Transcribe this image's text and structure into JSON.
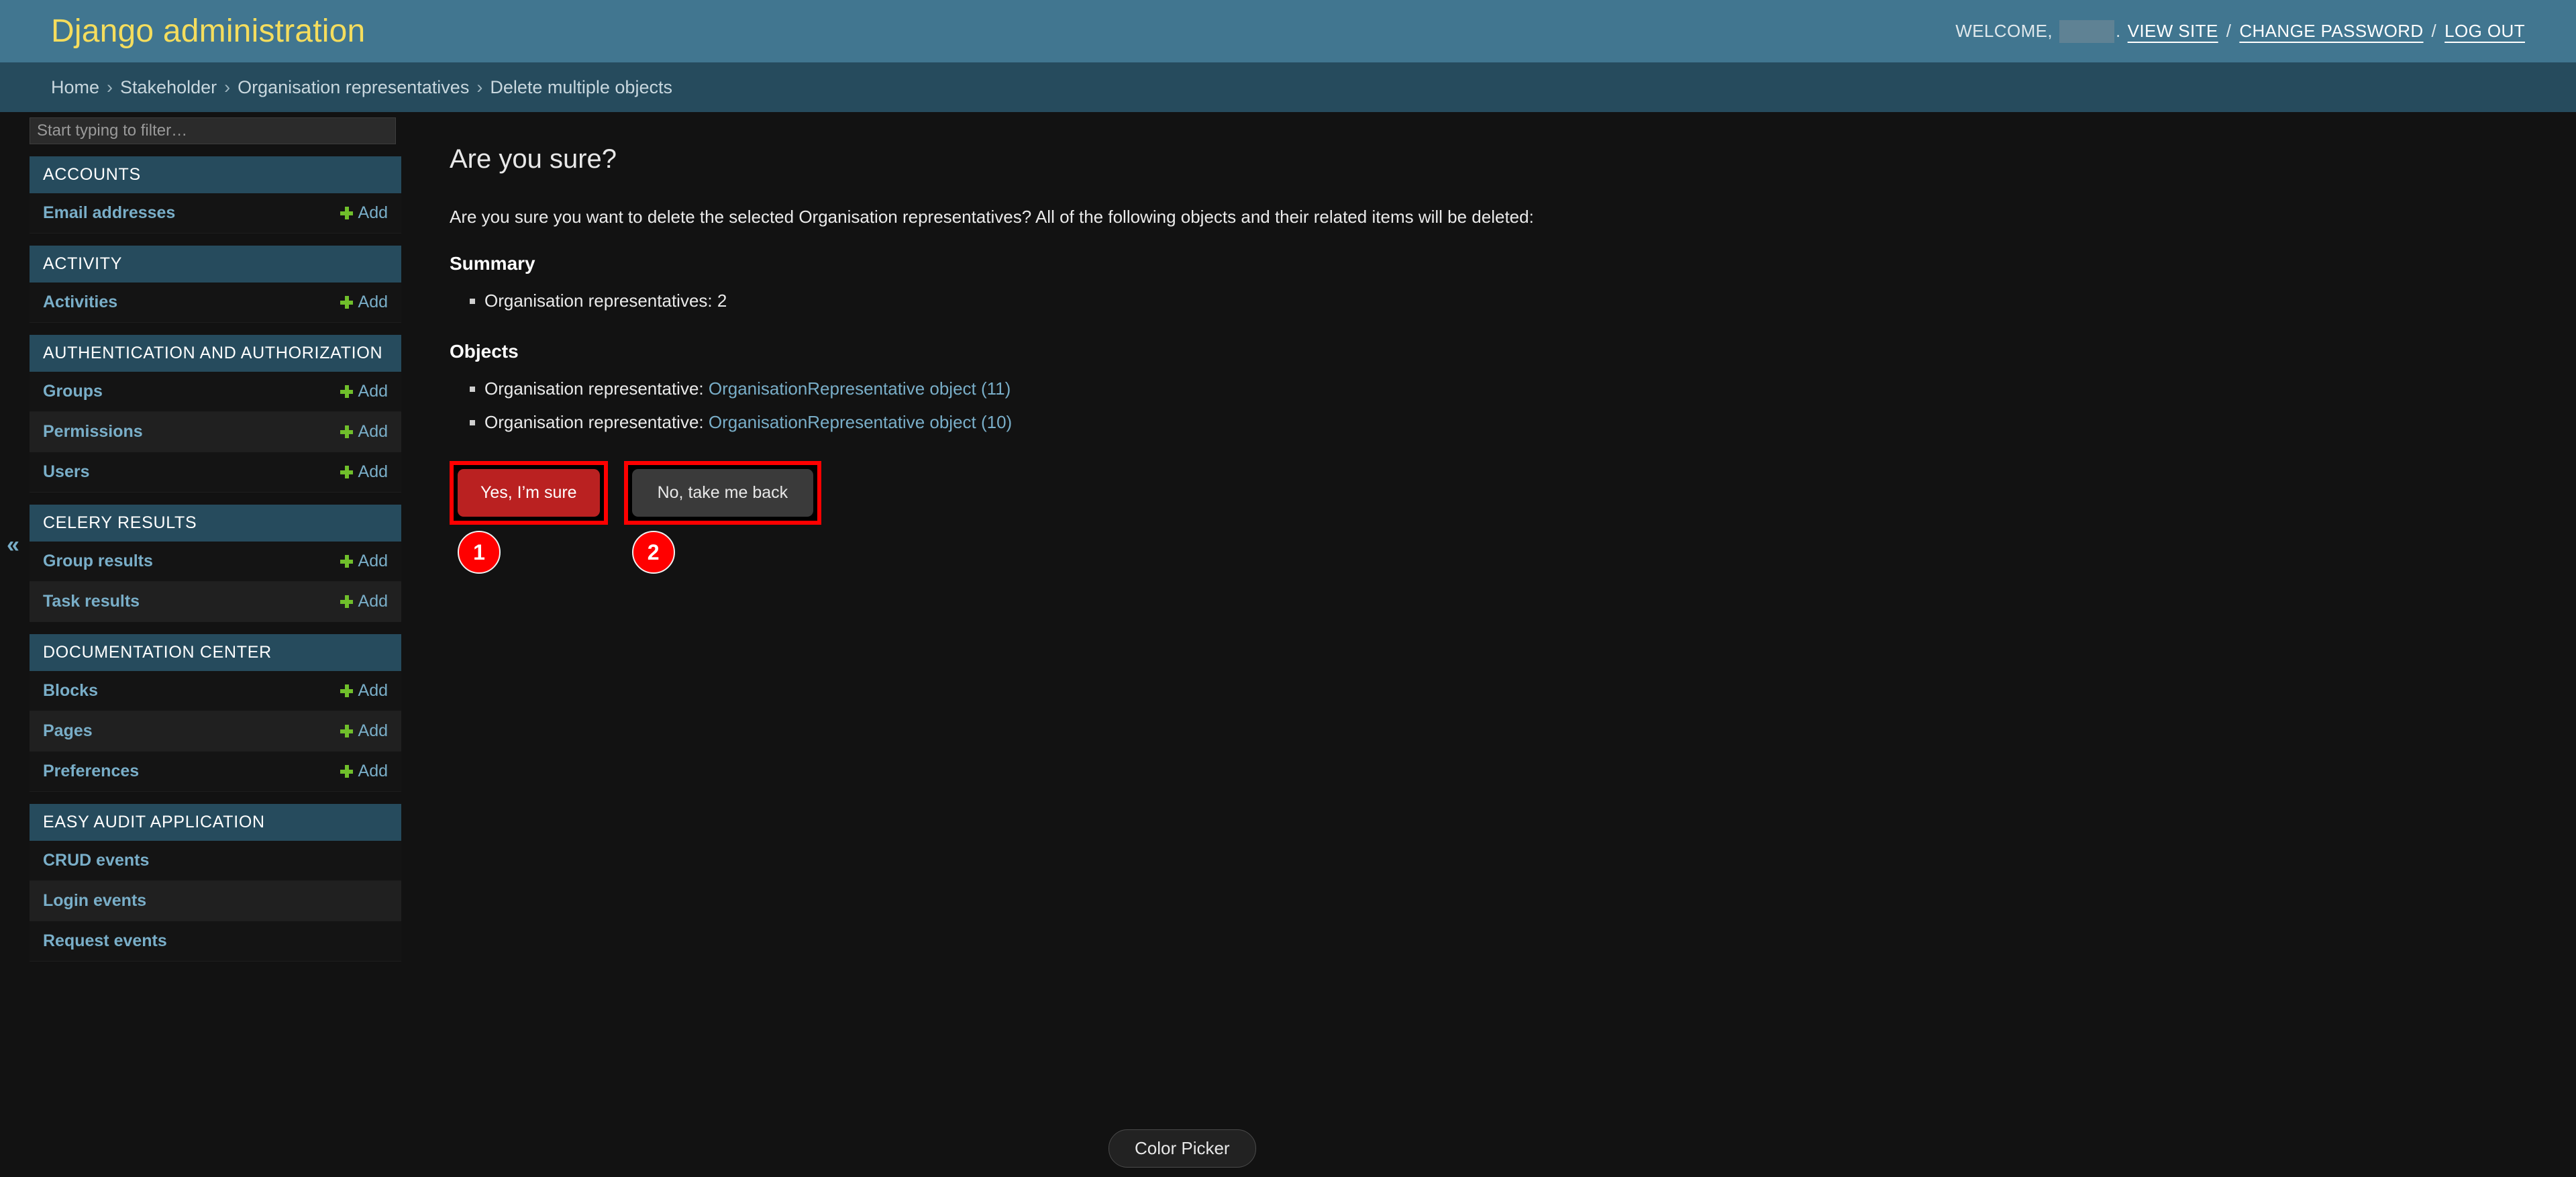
{
  "header": {
    "site_name": "Django administration",
    "welcome_label": "WELCOME,",
    "username_redacted": "",
    "period": ".",
    "view_site": "VIEW SITE",
    "change_password": "CHANGE PASSWORD",
    "log_out": "LOG OUT",
    "separator": "/",
    "brand_color": "#417690",
    "title_color": "#f5dd5d"
  },
  "breadcrumbs": {
    "items": [
      {
        "label": "Home",
        "current": false
      },
      {
        "label": "Stakeholder",
        "current": false
      },
      {
        "label": "Organisation representatives",
        "current": false
      },
      {
        "label": "Delete multiple objects",
        "current": true
      }
    ],
    "separator": "›",
    "bar_color": "#264b5d"
  },
  "sidebar": {
    "filter_placeholder": "Start typing to filter…",
    "filter_value": "",
    "collapse_icon": "«",
    "add_label": "Add",
    "apps": [
      {
        "caption": "ACCOUNTS",
        "models": [
          {
            "name": "Email addresses",
            "add": true
          }
        ]
      },
      {
        "caption": "ACTIVITY",
        "models": [
          {
            "name": "Activities",
            "add": true
          }
        ]
      },
      {
        "caption": "AUTHENTICATION AND AUTHORIZATION",
        "models": [
          {
            "name": "Groups",
            "add": true
          },
          {
            "name": "Permissions",
            "add": true
          },
          {
            "name": "Users",
            "add": true
          }
        ]
      },
      {
        "caption": "CELERY RESULTS",
        "models": [
          {
            "name": "Group results",
            "add": true
          },
          {
            "name": "Task results",
            "add": true
          }
        ]
      },
      {
        "caption": "DOCUMENTATION CENTER",
        "models": [
          {
            "name": "Blocks",
            "add": true
          },
          {
            "name": "Pages",
            "add": true
          },
          {
            "name": "Preferences",
            "add": true
          }
        ]
      },
      {
        "caption": "EASY AUDIT APPLICATION",
        "models": [
          {
            "name": "CRUD events",
            "add": false
          },
          {
            "name": "Login events",
            "add": false
          },
          {
            "name": "Request events",
            "add": false
          }
        ]
      }
    ]
  },
  "main": {
    "title": "Are you sure?",
    "intro": "Are you sure you want to delete the selected Organisation representatives? All of the following objects and their related items will be deleted:",
    "summary_heading": "Summary",
    "summary_items": [
      "Organisation representatives: 2"
    ],
    "objects_heading": "Objects",
    "object_items": [
      {
        "prefix": "Organisation representative:",
        "link": "OrganisationRepresentative object (11)"
      },
      {
        "prefix": "Organisation representative:",
        "link": "OrganisationRepresentative object (10)"
      }
    ],
    "confirm_button": "Yes, I’m sure",
    "cancel_button": "No, take me back",
    "confirm_color": "#ba2121",
    "cancel_color": "#3a3a3a",
    "annotations": [
      {
        "number": "1",
        "target": "confirm-button"
      },
      {
        "number": "2",
        "target": "cancel-button"
      }
    ],
    "annotation_color": "#ff0000"
  },
  "overlay": {
    "color_picker_label": "Color Picker"
  }
}
